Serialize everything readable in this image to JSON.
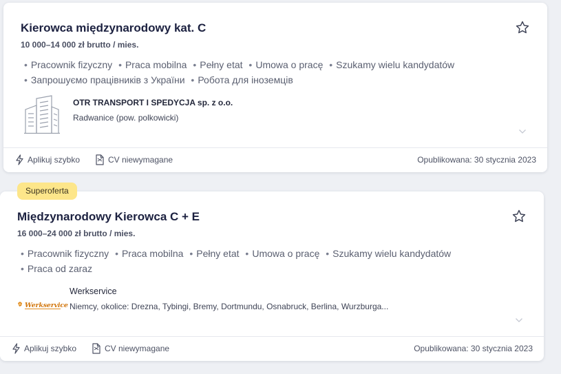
{
  "jobs": [
    {
      "title": "Kierowca międzynarodowy kat. C",
      "salary": "10 000–14 000 zł brutto / mies.",
      "tags_line1": [
        "Pracownik fizyczny",
        "Praca mobilna",
        "Pełny etat",
        "Umowa o pracę",
        "Szukamy wielu kandydatów"
      ],
      "tags_line2": [
        "Запрошуємо працівників з України",
        "Робота для іноземців"
      ],
      "company": "OTR TRANSPORT I SPEDYCJA sp. z o.o.",
      "location": "Radwanice (pow. polkowicki)",
      "apply_label": "Aplikuj szybko",
      "cv_label": "CV niewymagane",
      "published": "Opublikowana: 30 stycznia 2023",
      "logo_icon": "building-icon"
    },
    {
      "badge": "Superoferta",
      "title": "Międzynarodowy Kierowca C + E",
      "salary": "16 000–24 000 zł brutto / mies.",
      "tags_line1": [
        "Pracownik fizyczny",
        "Praca mobilna",
        "Pełny etat",
        "Umowa o pracę",
        "Szukamy wielu kandydatów"
      ],
      "tags_line2": [
        "Praca od zaraz"
      ],
      "company": "Werkservice",
      "logo_text": "Werkservice",
      "location": "Niemcy, okolice: Drezna, Tybingi, Bremy, Dortmundu, Osnabruck, Berlina, Wurzburga...",
      "apply_label": "Aplikuj szybko",
      "cv_label": "CV niewymagane",
      "published": "Opublikowana: 30 stycznia 2023"
    }
  ],
  "icons": {
    "star": "star-outline-icon",
    "apply": "lightning-icon",
    "cv": "document-icon",
    "expand": "chevron-down-icon"
  },
  "colors": {
    "badge_bg": "#fde68a",
    "title": "#1c2140",
    "background": "#eef0f4"
  }
}
